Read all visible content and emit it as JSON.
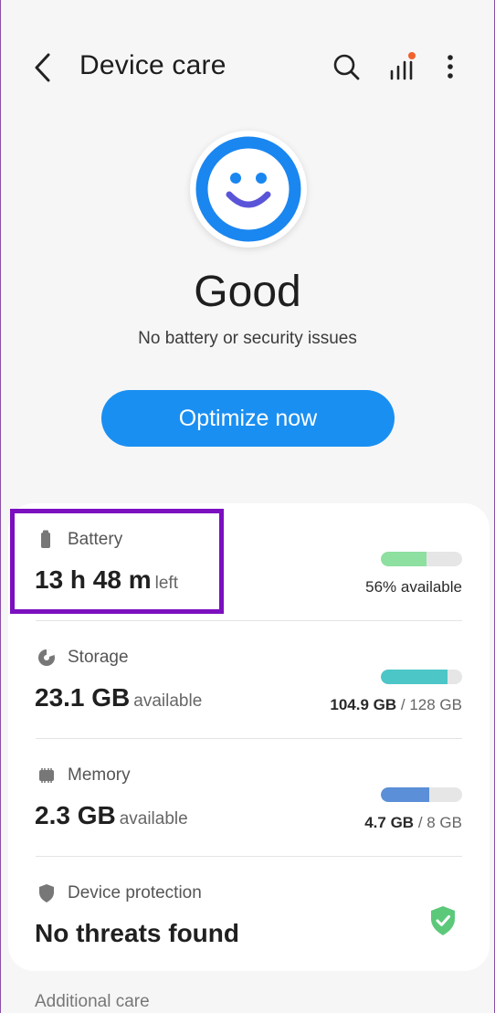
{
  "header": {
    "title": "Device care"
  },
  "status": {
    "title": "Good",
    "subtitle": "No battery or security issues"
  },
  "optimize_label": "Optimize now",
  "rows": {
    "battery": {
      "label": "Battery",
      "value": "13 h 48 m",
      "unit": "left",
      "right": "56% available",
      "fill_fraction": 0.56,
      "color": "#8de0a0"
    },
    "storage": {
      "label": "Storage",
      "value": "23.1 GB",
      "unit": "available",
      "used": "104.9 GB",
      "total": "/ 128 GB",
      "fill_fraction": 0.82,
      "color": "#4cc6c6"
    },
    "memory": {
      "label": "Memory",
      "value": "2.3 GB",
      "unit": "available",
      "used": "4.7 GB",
      "total": "/ 8 GB",
      "fill_fraction": 0.59,
      "color": "#5b8fd8"
    },
    "protection": {
      "label": "Device protection",
      "value": "No threats found"
    }
  },
  "additional_care": "Additional care",
  "colors": {
    "accent": "#1a8ff2",
    "highlight": "#7c0fbf",
    "shield": "#5cc97a"
  },
  "icons": [
    "back-arrow-icon",
    "search-icon",
    "signal-bars-icon",
    "more-options-icon",
    "smiley-face-icon",
    "battery-icon",
    "storage-pie-icon",
    "memory-chip-icon",
    "shield-icon",
    "shield-check-icon"
  ]
}
